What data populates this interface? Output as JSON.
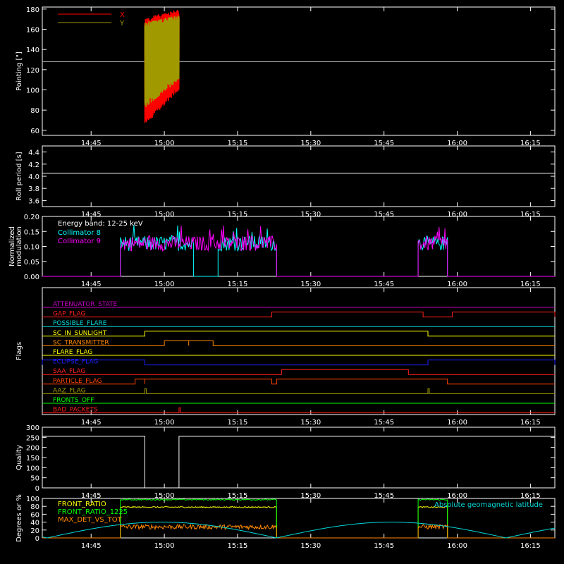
{
  "time_axis": {
    "start": "14:35",
    "end": "16:20",
    "tick_labels": [
      "14:45",
      "15:00",
      "15:15",
      "15:30",
      "15:45",
      "16:00",
      "16:15"
    ],
    "tick_times": [
      "14:45",
      "15:00",
      "15:15",
      "15:30",
      "15:45",
      "16:00",
      "16:15"
    ]
  },
  "chart_data": [
    {
      "type": "line",
      "ylabel": "Pointing [\"]",
      "ylim": [
        55,
        182
      ],
      "yticks": [
        60,
        80,
        100,
        120,
        140,
        160,
        180
      ],
      "legend_placement": "top-left",
      "series": [
        {
          "name": "X",
          "color": "#ff0000",
          "kind": "oscillation",
          "x_range": [
            "14:56",
            "15:03"
          ],
          "y_range": [
            65,
            180
          ]
        },
        {
          "name": "Y",
          "color": "#a09a00",
          "kind": "oscillation",
          "x_range": [
            "14:56",
            "15:03"
          ],
          "y_range": [
            82,
            174
          ]
        }
      ],
      "reference_lines": [
        {
          "y": 128,
          "color": "#b0b0b0"
        }
      ]
    },
    {
      "type": "line",
      "ylabel": "Roll period [s]",
      "ylim": [
        3.5,
        4.5
      ],
      "yticks": [
        3.6,
        3.8,
        4.0,
        4.2,
        4.4
      ],
      "yticklabels": [
        "3.6",
        "3.8",
        "4.0",
        "4.2",
        "4.4"
      ],
      "series": [
        {
          "color": "#ffffff",
          "x": [
            "14:35",
            "16:20"
          ],
          "y": [
            4.05,
            4.05
          ]
        }
      ]
    },
    {
      "type": "line",
      "ylabel": "Normalized modulation",
      "ylim": [
        0,
        0.2
      ],
      "yticks": [
        0,
        0.05,
        0.1,
        0.15,
        0.2
      ],
      "yticklabels": [
        "0.00",
        "0.05",
        "0.10",
        "0.15",
        "0.20"
      ],
      "annotation": "Energy band: 12-25 keV",
      "legend_placement": "top-left",
      "series": [
        {
          "name": "Collimator 8",
          "color": "#00ffff",
          "segments": [
            [
              "14:51",
              "15:06"
            ],
            [
              "15:11",
              "15:23"
            ],
            [
              "15:52",
              "15:58"
            ]
          ],
          "level": 0.11
        },
        {
          "name": "Collimator 9",
          "color": "#ff00ff",
          "segments": [
            [
              "14:51",
              "15:23"
            ],
            [
              "15:52",
              "15:58"
            ]
          ],
          "level": 0.11
        }
      ]
    },
    {
      "type": "line",
      "ylabel": "Flags",
      "series": [
        {
          "name": "ATTENUATOR_STATE",
          "color": "#c000c0",
          "transitions": []
        },
        {
          "name": "GAP_FLAG",
          "color": "#ff2020",
          "transitions": [
            [
              "15:22",
              "15:53"
            ],
            [
              "15:59",
              "16:20"
            ]
          ]
        },
        {
          "name": "POSSIBLE_FLARE",
          "color": "#00d8d8",
          "transitions": []
        },
        {
          "name": "SC_IN_SUNLIGHT",
          "color": "#ffff00",
          "transitions": [
            [
              "14:56",
              "15:54"
            ]
          ]
        },
        {
          "name": "SC_TRANSMITTER",
          "color": "#ff8800",
          "transitions": [
            [
              "15:00",
              "15:05"
            ],
            [
              "15:05",
              "15:10"
            ]
          ]
        },
        {
          "name": "FLARE_FLAG",
          "color": "#ffff00",
          "transitions": []
        },
        {
          "name": "ECLIPSE_FLAG",
          "color": "#2020ff",
          "transitions": [
            [
              "14:35",
              "14:56"
            ],
            [
              "15:54",
              "16:20"
            ]
          ]
        },
        {
          "name": "SAA_FLAG",
          "color": "#ff2020",
          "transitions": [
            [
              "15:24",
              "15:50"
            ]
          ]
        },
        {
          "name": "PARTICLE_FLAG",
          "color": "#ff4400",
          "transitions": [
            [
              "14:54",
              "14:56"
            ],
            [
              "14:56",
              "15:22"
            ],
            [
              "15:23",
              "15:58"
            ]
          ]
        },
        {
          "name": "AAZ_FLAG",
          "color": "#a09a00",
          "transitions": [
            [
              "14:56",
              "14:56"
            ],
            [
              "15:54",
              "15:54"
            ]
          ]
        },
        {
          "name": "FRONTS_OFF",
          "color": "#00ff00",
          "transitions": []
        },
        {
          "name": "BAD_PACKETS",
          "color": "#ff2020",
          "transitions": [
            [
              "15:03",
              "15:03"
            ]
          ]
        }
      ]
    },
    {
      "type": "line",
      "ylabel": "Quality",
      "ylim": [
        0,
        300
      ],
      "yticks": [
        0,
        50,
        100,
        150,
        200,
        250,
        300
      ],
      "series": [
        {
          "color": "#ffffff",
          "x": [
            "14:35",
            "14:56",
            "14:56",
            "15:03",
            "15:03",
            "16:20"
          ],
          "y": [
            255,
            255,
            0,
            0,
            255,
            255
          ]
        }
      ]
    },
    {
      "type": "line",
      "ylabel": "Degrees or %",
      "ylim": [
        0,
        100
      ],
      "yticks": [
        0,
        20,
        40,
        60,
        80,
        100
      ],
      "annotation": "Absolute geomagnetic latitude",
      "legend_placement": "top-left",
      "series": [
        {
          "name": "FRONT_RATIO",
          "color": "#ffff00",
          "segments": [
            [
              "14:51",
              "15:23"
            ],
            [
              "15:52",
              "15:58"
            ]
          ],
          "level": 78
        },
        {
          "name": "FRONT_RATIO_1225",
          "color": "#00ff00",
          "segments": [
            [
              "14:51",
              "15:23"
            ],
            [
              "15:52",
              "15:58"
            ]
          ],
          "level": 97
        },
        {
          "name": "MAX_DET_VS_TOT",
          "color": "#ff8800",
          "segments": [
            [
              "14:51",
              "15:23"
            ],
            [
              "15:52",
              "15:58"
            ]
          ],
          "level": 28
        },
        {
          "name": "Absolute geomagnetic latitude",
          "color": "#00d8d8",
          "kind": "arches",
          "peaks": [
            "15:00",
            "15:45",
            "16:30"
          ],
          "zeros": [
            "14:36",
            "15:23",
            "16:08"
          ],
          "peak_value": 40
        }
      ]
    }
  ]
}
